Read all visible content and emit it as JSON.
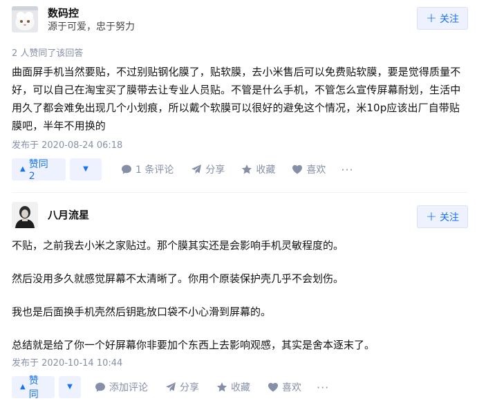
{
  "answers": [
    {
      "author": {
        "name": "数码控",
        "bio": "源于可爱，忠于努力"
      },
      "follow_label": "关注",
      "voters_text": "2 人赞同了该回答",
      "content": "曲面屏手机当然要贴，不过别贴钢化膜了，贴软膜，去小米售后可以免费贴软膜，要是觉得质量不好，可以自己在淘宝买了膜带去让专业人员贴。不管是什么手机，不管怎么宣传屏幕耐划，生活中用久了都会难免出现几个小划痕，所以戴个软膜可以很好的避免这个情况，米10p应该出厂自带贴膜吧，半年不用换的",
      "time": "发布于 2020-08-24 06:18",
      "vote_label": "赞同 2",
      "comment_label": "1 条评论",
      "share_label": "分享",
      "collect_label": "收藏",
      "like_label": "喜欢",
      "more_label": "···"
    },
    {
      "author": {
        "name": "八月流星",
        "bio": ""
      },
      "follow_label": "关注",
      "paragraphs": [
        "不贴，之前我去小米之家贴过。那个膜其实还是会影响手机灵敏程度的。",
        "然后没用多久就感觉屏幕不太清晰了。你用个原装保护壳几乎不会划伤。",
        "我也是后面换手机壳然后钥匙放口袋不小心滑到屏幕的。",
        "总结就是给了你一个好屏幕你非要加个东西上去影响观感，其实是舍本逐末了。"
      ],
      "time": "发布于 2020-10-14 10:44",
      "vote_label": "赞同",
      "comment_label": "添加评论",
      "share_label": "分享",
      "collect_label": "收藏",
      "like_label": "喜欢",
      "more_label": "···"
    }
  ],
  "icons": {
    "follow": "plus-icon",
    "vote_up": "triangle-up-icon",
    "vote_down": "triangle-down-icon",
    "comment": "comment-bubble-icon",
    "share": "paper-plane-icon",
    "collect": "star-icon",
    "like": "heart-icon",
    "more": "ellipsis-icon"
  },
  "colors": {
    "accent": "#1772f6",
    "accent_bg": "#eef2ff",
    "meta": "#8590a6",
    "text": "#121212"
  }
}
